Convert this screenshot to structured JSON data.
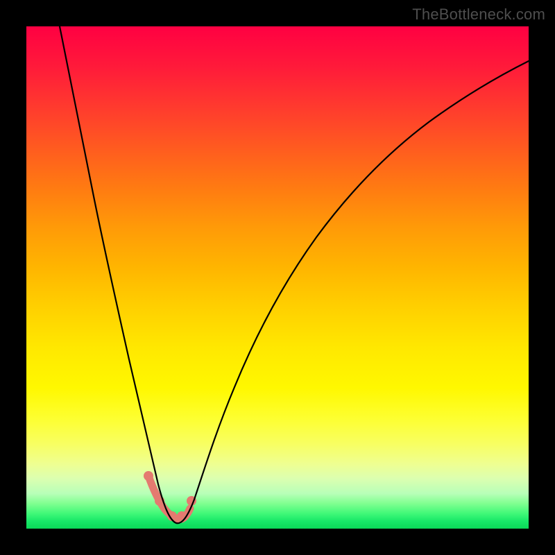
{
  "watermark": "TheBottleneck.com",
  "colors": {
    "peach": "#e47a70",
    "curve": "#000000"
  },
  "chart_data": {
    "type": "line",
    "title": "",
    "xlabel": "",
    "ylabel": "",
    "xlim": [
      0,
      100
    ],
    "ylim": [
      0,
      100
    ],
    "grid": false,
    "legend": false,
    "description": "Bottleneck-style V-curve on a rainbow heat gradient background. Left branch falls steeply from the top-left; right branch rises more gently toward the top-right. A short salmon-colored segment with dots highlights the valley minimum (optimal / no-bottleneck zone) near x≈27–32.",
    "series": [
      {
        "name": "curve",
        "x": [
          7,
          8,
          9,
          10,
          12,
          14,
          16,
          18,
          20,
          22,
          24,
          26,
          27,
          28,
          29,
          30,
          31,
          32,
          33,
          35,
          38,
          42,
          48,
          55,
          62,
          70,
          78,
          86,
          94,
          100
        ],
        "y": [
          100,
          94,
          88,
          82,
          72,
          63,
          54,
          46,
          38,
          30,
          22,
          14,
          10,
          7,
          5,
          3.5,
          3,
          3.5,
          5,
          9,
          16,
          26,
          38,
          50,
          59,
          67,
          73,
          78,
          82,
          85
        ]
      },
      {
        "name": "optimal-zone-highlight",
        "x": [
          25.5,
          27,
          29,
          31,
          32.5
        ],
        "y": [
          12,
          8,
          4,
          4,
          7
        ]
      }
    ]
  }
}
